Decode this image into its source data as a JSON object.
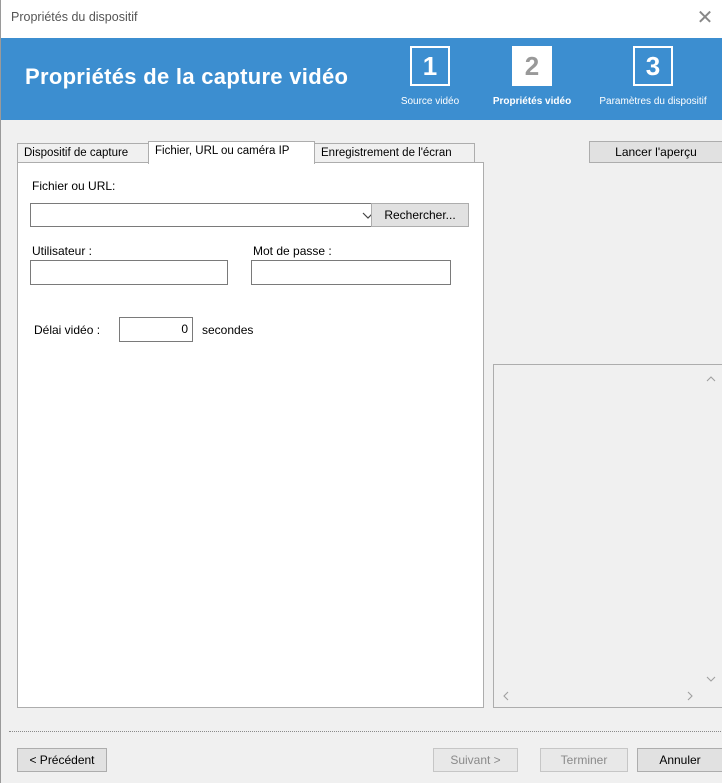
{
  "window": {
    "title": "Propriétés du dispositif",
    "close_glyph": "✕"
  },
  "header": {
    "title": "Propriétés de la capture vidéo",
    "steps": [
      {
        "number": "1",
        "label": "Source vidéo",
        "active": false
      },
      {
        "number": "2",
        "label": "Propriétés vidéo",
        "active": true
      },
      {
        "number": "3",
        "label": "Paramètres du dispositif",
        "active": false
      }
    ],
    "color": "#3c8ed0"
  },
  "tabs": [
    {
      "label": "Dispositif de capture",
      "active": false
    },
    {
      "label": "Fichier, URL ou caméra IP",
      "active": true
    },
    {
      "label": "Enregistrement de l'écran",
      "active": false
    }
  ],
  "form": {
    "file_url_label": "Fichier ou URL:",
    "file_url_value": "",
    "browse_button": "Rechercher...",
    "user_label": "Utilisateur :",
    "user_value": "",
    "password_label": "Mot de passe :",
    "password_value": "",
    "delay_label": "Délai vidéo :",
    "delay_value": "0",
    "delay_unit": "secondes"
  },
  "preview": {
    "start_button": "Lancer l'aperçu"
  },
  "footer": {
    "previous_button": "< Précédent",
    "next_button": "Suivant >",
    "finish_button": "Terminer",
    "cancel_button": "Annuler"
  }
}
